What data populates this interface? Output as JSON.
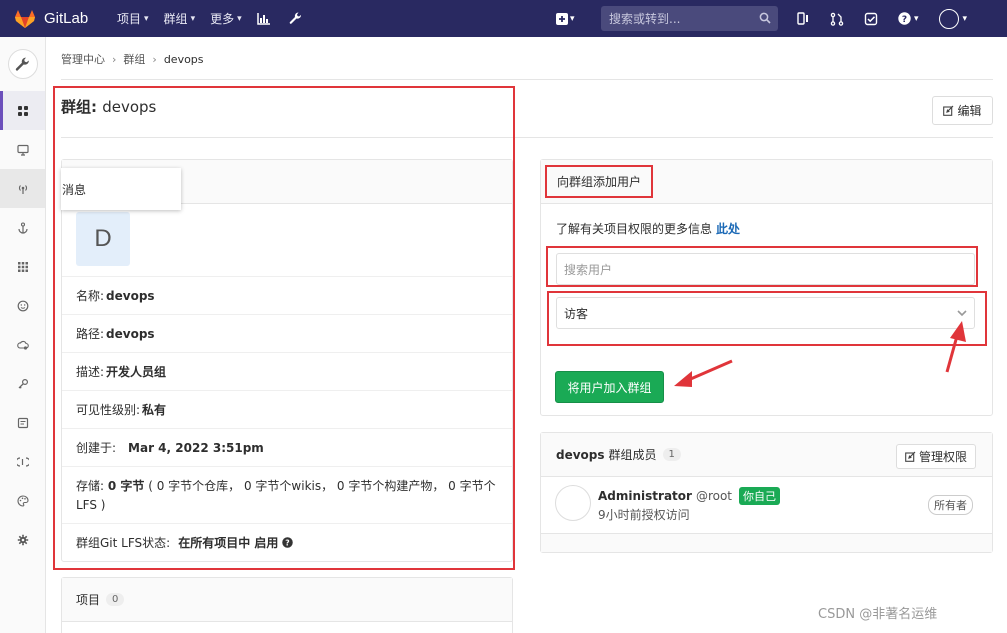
{
  "navbar": {
    "brand": "GitLab",
    "menu": [
      {
        "label": "项目"
      },
      {
        "label": "群组"
      },
      {
        "label": "更多"
      }
    ],
    "search_placeholder": "搜索或转到..."
  },
  "breadcrumb": {
    "items": [
      "管理中心",
      "群组",
      "devops"
    ]
  },
  "page": {
    "title_prefix": "群组: ",
    "title_name": "devops",
    "edit_label": "编辑"
  },
  "tooltip": "消息",
  "group": {
    "avatar_letter": "D",
    "rows": [
      {
        "label": "名称: ",
        "value": "devops"
      },
      {
        "label": "路径: ",
        "value": "devops"
      },
      {
        "label": "描述: ",
        "value": "开发人员组"
      },
      {
        "label": "可见性级别: ",
        "value": "私有"
      },
      {
        "label": "创建于:",
        "value": "Mar 4, 2022 3:51pm"
      }
    ],
    "storage_label": "存储: ",
    "storage_value": "0 字节",
    "storage_detail_1": " ( 0 字节个仓库， 0 字节个wikis， 0 字节个构建产物， 0 字节个",
    "storage_detail_2": "LFS )",
    "lfs_label": "群组Git LFS状态: ",
    "lfs_value": "在所有项目中 启用"
  },
  "add_user": {
    "header": "向群组添加用户",
    "info_text": "了解有关项目权限的更多信息",
    "info_link": "此处",
    "search_placeholder": "搜索用户",
    "role_selected": "访客",
    "submit_label": "将用户加入群组"
  },
  "members": {
    "group_name": "devops",
    "header_label": "群组成员",
    "count": "1",
    "manage_label": "管理权限",
    "list": [
      {
        "name": "Administrator",
        "username": "@root",
        "self_badge": "你自己",
        "time": "9小时前授权访问",
        "role": "所有者"
      }
    ]
  },
  "projects": {
    "label": "项目",
    "count": "0"
  },
  "watermark": "CSDN @非著名运维",
  "colors": {
    "navbar": "#292961",
    "accent": "#6b4fbb",
    "success": "#1aaa55",
    "link": "#1b69b6",
    "highlight": "#e0353a"
  }
}
